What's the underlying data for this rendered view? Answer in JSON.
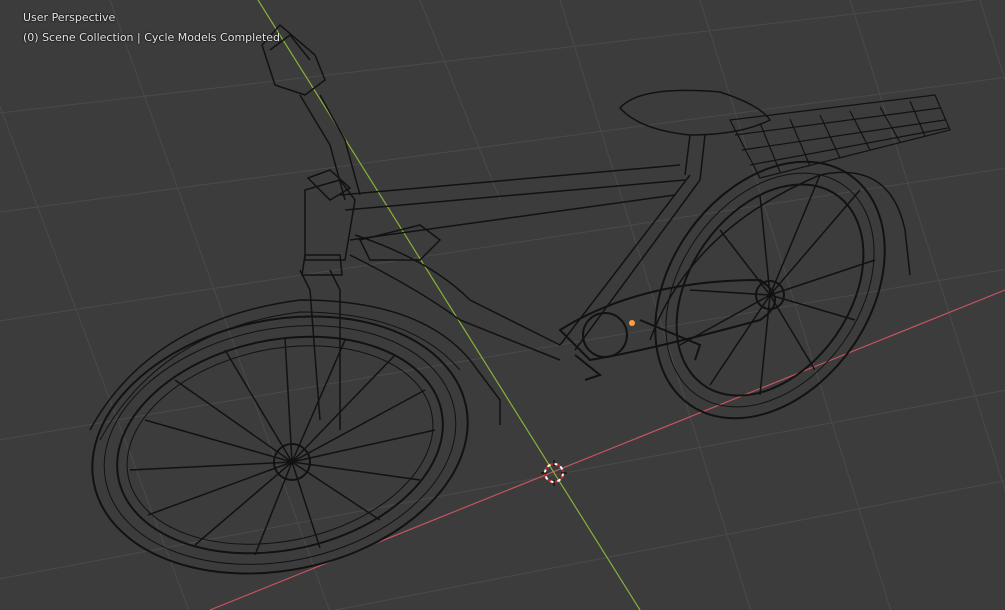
{
  "viewport": {
    "view_name": "User Perspective",
    "scene_info": "(0) Scene Collection | Cycle Models Completed",
    "object_name": "bicycle",
    "colors": {
      "background": "#3c3c3c",
      "grid": "#4a4a4a",
      "x_axis": "#c4545e",
      "y_axis": "#86b03a",
      "wire": "#121212"
    }
  }
}
